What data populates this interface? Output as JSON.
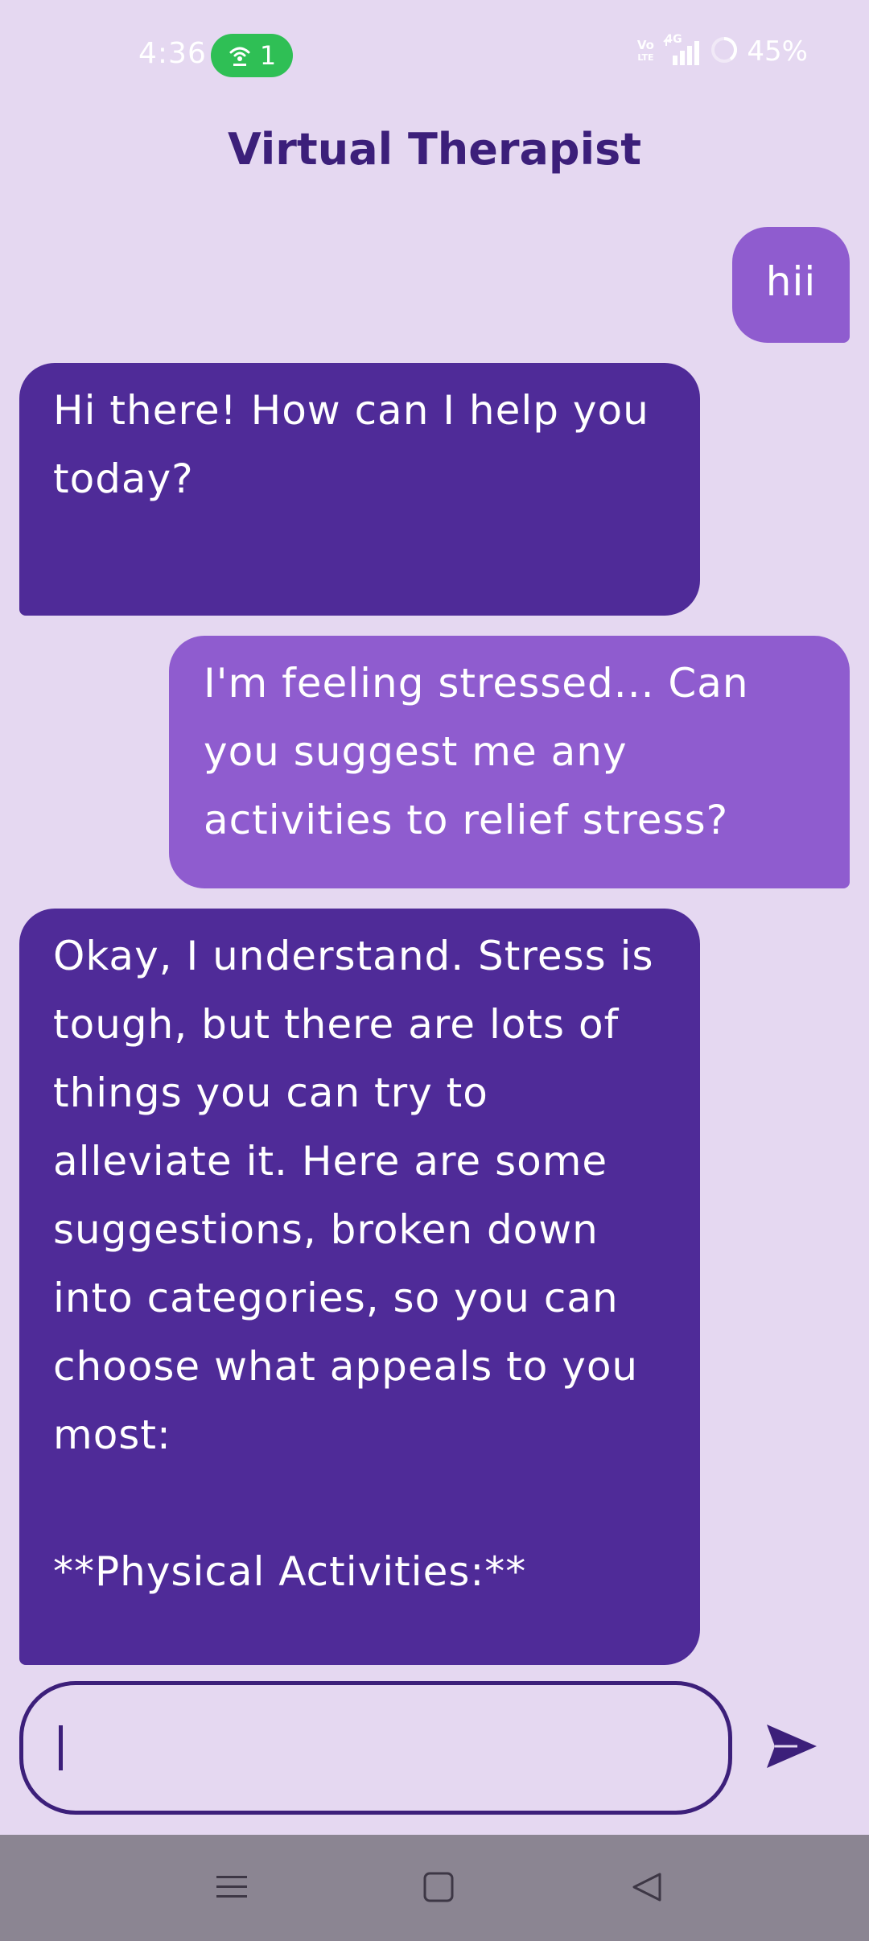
{
  "status_bar": {
    "time": "4:36",
    "hotspot_count": "1",
    "volte_top": "Vo",
    "volte_bottom": "LTE",
    "network": "4G",
    "battery": "45%"
  },
  "header": {
    "title": "Virtual Therapist"
  },
  "messages": [
    {
      "role": "user",
      "text": "hii"
    },
    {
      "role": "bot",
      "text": "Hi there! How can I help you today?"
    },
    {
      "role": "user",
      "text": "I'm feeling stressed... Can you suggest me any activities to relief stress?"
    },
    {
      "role": "bot",
      "text": "Okay, I understand. Stress is tough, but there are lots of things you can try to alleviate it. Here are some suggestions, broken down into categories, so you can choose what appeals to you most:\n\n**Physical Activities:**"
    }
  ],
  "input": {
    "value": "",
    "placeholder": ""
  },
  "colors": {
    "background": "#e5d8f1",
    "user_bubble": "#8f5ccf",
    "bot_bubble": "#4f2b98",
    "accent": "#3c1f7a",
    "hotspot": "#2fbf55",
    "nav_bar": "#8b8592"
  },
  "icons": {
    "send": "send-icon",
    "hotspot": "hotspot-icon",
    "signal": "signal-icon",
    "battery": "battery-ring-icon",
    "nav_menu": "menu-icon",
    "nav_home": "home-icon",
    "nav_back": "back-icon"
  }
}
